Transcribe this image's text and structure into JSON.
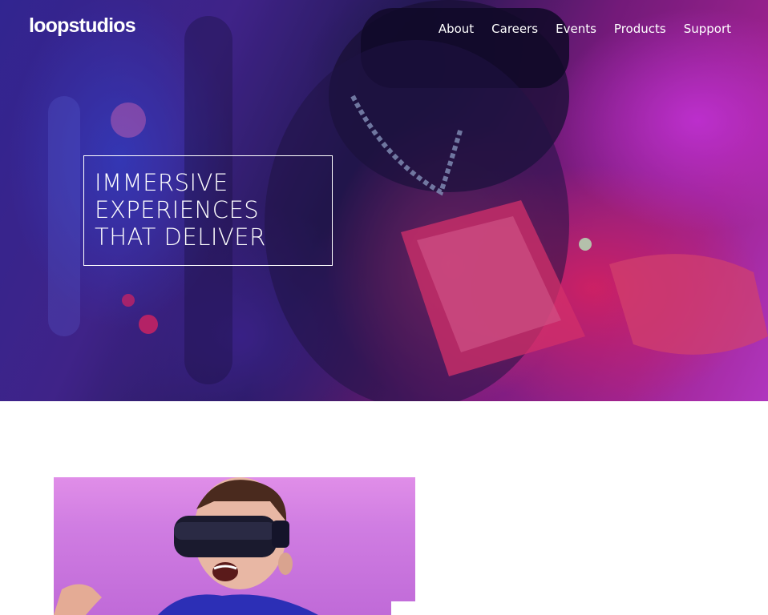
{
  "header": {
    "logo": "loopstudios",
    "nav": [
      {
        "label": "About"
      },
      {
        "label": "Careers"
      },
      {
        "label": "Events"
      },
      {
        "label": "Products"
      },
      {
        "label": "Support"
      }
    ]
  },
  "hero": {
    "title_lines": [
      "IMMERSIVE",
      "EXPERIENCES",
      "THAT DELIVER"
    ]
  },
  "colors": {
    "text_on_dark": "#ffffff",
    "page_background": "#ffffff",
    "accent_magenta": "#d441e0",
    "accent_violet": "#3a2ca8"
  }
}
